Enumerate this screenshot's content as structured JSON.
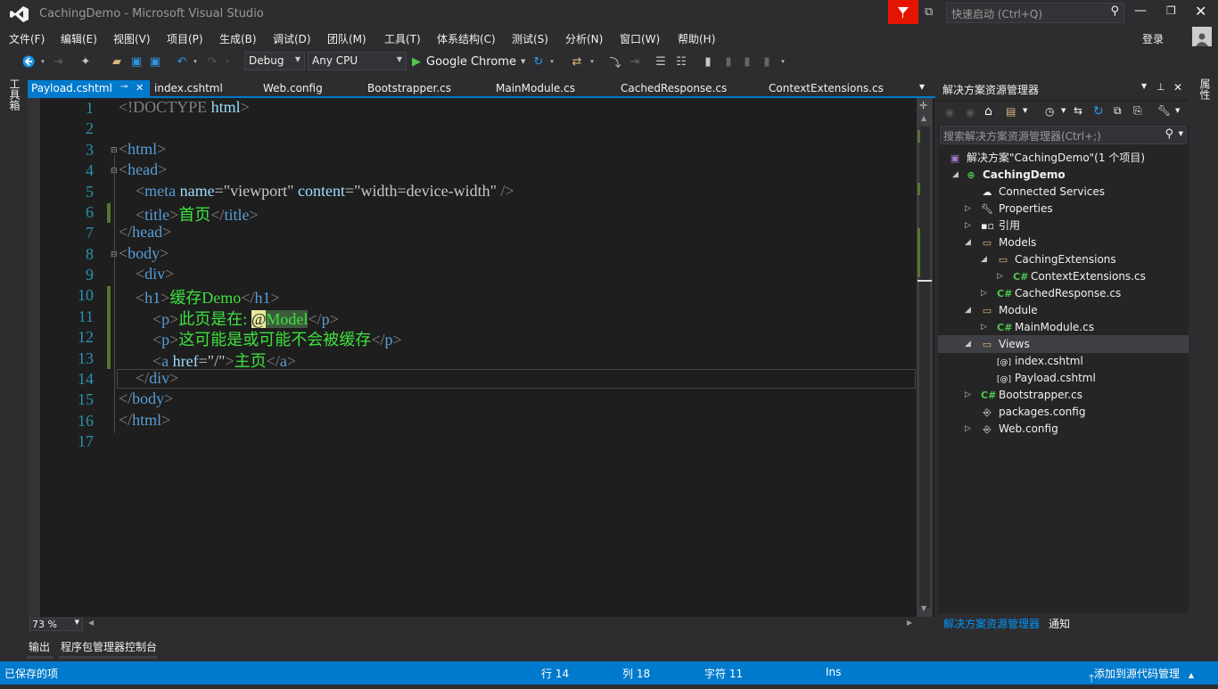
{
  "titlebar": {
    "title": "CachingDemo - Microsoft Visual Studio",
    "quick_launch_placeholder": "快速启动 (Ctrl+Q)"
  },
  "menu": {
    "items": [
      "文件(F)",
      "编辑(E)",
      "视图(V)",
      "项目(P)",
      "生成(B)",
      "调试(D)",
      "团队(M)",
      "工具(T)",
      "体系结构(C)",
      "测试(S)",
      "分析(N)",
      "窗口(W)",
      "帮助(H)"
    ],
    "signin": "登录"
  },
  "toolbar": {
    "config": "Debug",
    "platform": "Any CPU",
    "run_target": "Google Chrome"
  },
  "left_strip": {
    "label": "工具箱"
  },
  "right_strip": {
    "label": "属性"
  },
  "tabs": [
    "Payload.cshtml",
    "index.cshtml",
    "Web.config",
    "Bootstrapper.cs",
    "MainModule.cs",
    "CachedResponse.cs",
    "ContextExtensions.cs"
  ],
  "editor": {
    "line_numbers": [
      "1",
      "2",
      "3",
      "4",
      "5",
      "6",
      "7",
      "8",
      "9",
      "10",
      "11",
      "12",
      "13",
      "14",
      "15",
      "16",
      "17"
    ],
    "lines": {
      "l1": {
        "open": "<!DOCTYPE",
        "kw": "html",
        "close": ">"
      },
      "l3": {
        "open": "<",
        "name": "html",
        "close": ">"
      },
      "l4": {
        "open": "<",
        "name": "head",
        "close": ">"
      },
      "l5": {
        "open": "<",
        "name": "meta",
        "a1": "name",
        "eq1": "=",
        "v1": "\"viewport\"",
        "a2": "content",
        "eq2": "=",
        "v2": "\"width=device-width\"",
        "close": " />"
      },
      "l6": {
        "open": "<",
        "name": "title",
        "close": ">",
        "text": "首页",
        "end_open": "</",
        "end_name": "title",
        "end_close": ">"
      },
      "l7": {
        "open": "</",
        "name": "head",
        "close": ">"
      },
      "l8": {
        "open": "<",
        "name": "body",
        "close": ">"
      },
      "l9": {
        "open": "<",
        "name": "div",
        "close": ">"
      },
      "l10": {
        "open": "<",
        "name": "h1",
        "close": ">",
        "text": "缓存Demo",
        "end_open": "</",
        "end_name": "h1",
        "end_close": ">"
      },
      "l11": {
        "open": "<",
        "name": "p",
        "close": ">",
        "text": "此页是在: ",
        "at": "@",
        "model": "Model",
        "end_open": "</",
        "end_name": "p",
        "end_close": ">"
      },
      "l12": {
        "open": "<",
        "name": "p",
        "close": ">",
        "text": "这可能是或可能不会被缓存",
        "end_open": "</",
        "end_name": "p",
        "end_close": ">"
      },
      "l13": {
        "open": "<",
        "name": "a",
        "a1": "href",
        "eq1": "=",
        "v1": "\"/\"",
        "close": ">",
        "text": "主页",
        "end_open": "</",
        "end_name": "a",
        "end_close": ">"
      },
      "l14": {
        "open": "</",
        "name": "div",
        "close": ">"
      },
      "l15": {
        "open": "</",
        "name": "body",
        "close": ">"
      },
      "l16": {
        "open": "</",
        "name": "html",
        "close": ">"
      }
    },
    "zoom": "73 %"
  },
  "solution_explorer": {
    "title": "解决方案资源管理器",
    "search_placeholder": "搜索解决方案资源管理器(Ctrl+;)",
    "nodes": [
      "解决方案\"CachingDemo\"(1 个项目)",
      "CachingDemo",
      "Connected Services",
      "Properties",
      "引用",
      "Models",
      "CachingExtensions",
      "ContextExtensions.cs",
      "CachedResponse.cs",
      "Module",
      "MainModule.cs",
      "Views",
      "index.cshtml",
      "Payload.cshtml",
      "Bootstrapper.cs",
      "packages.config",
      "Web.config"
    ],
    "bottom_tabs": [
      "解决方案资源管理器",
      "通知"
    ]
  },
  "output_tabs": [
    "输出",
    "程序包管理器控制台"
  ],
  "status": {
    "left": "已保存的项",
    "line": "行 14",
    "col": "列 18",
    "char": "字符 11",
    "mode": "Ins",
    "source_control": "添加到源代码管理"
  },
  "colors": {
    "accent": "#007acc",
    "tag": "#569cd6",
    "attr": "#9cdcfe",
    "text_green": "#3ee13e"
  }
}
